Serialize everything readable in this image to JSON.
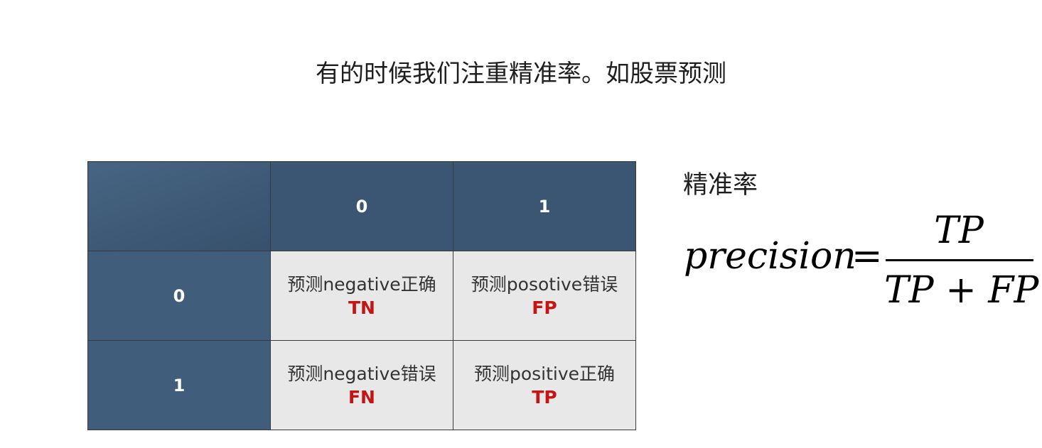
{
  "title": "有的时候我们注重精准率。如股票预测",
  "matrix": {
    "col_headers": [
      "0",
      "1"
    ],
    "row_headers": [
      "0",
      "1"
    ],
    "cells": [
      [
        {
          "desc": "预测negative正确",
          "abbr": "TN"
        },
        {
          "desc": "预测posotive错误",
          "abbr": "FP"
        }
      ],
      [
        {
          "desc": "预测negative错误",
          "abbr": "FN"
        },
        {
          "desc": "预测positive正确",
          "abbr": "TP"
        }
      ]
    ]
  },
  "metric": {
    "label": "精准率",
    "lhs": "precision",
    "equals": "=",
    "numerator": "TP",
    "denominator": "TP + FP"
  },
  "colors": {
    "header_bg": "#3a5673",
    "cell_bg": "#e8e8e8",
    "abbr_color": "#c41414"
  }
}
